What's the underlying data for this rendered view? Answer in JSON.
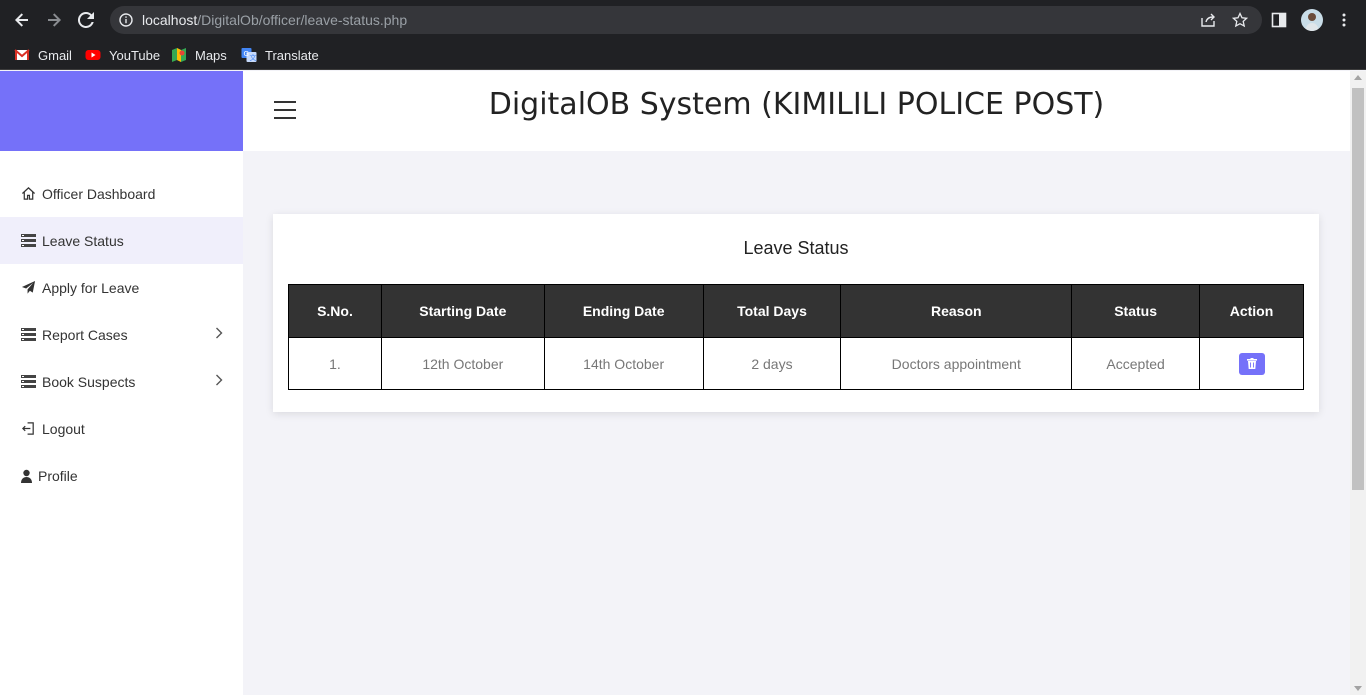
{
  "browser": {
    "url_host": "localhost",
    "url_path": "/DigitalOb/officer/leave-status.php",
    "bookmarks": [
      {
        "label": "Gmail",
        "icon": "gmail-icon"
      },
      {
        "label": "YouTube",
        "icon": "youtube-icon"
      },
      {
        "label": "Maps",
        "icon": "maps-icon"
      },
      {
        "label": "Translate",
        "icon": "translate-icon"
      }
    ]
  },
  "header": {
    "title": "DigitalOB System (KIMILILI POLICE POST)"
  },
  "sidebar": {
    "brand_color": "#7571f9",
    "items": [
      {
        "label": "Officer Dashboard",
        "icon": "home-icon",
        "active": false,
        "has_submenu": false
      },
      {
        "label": "Leave Status",
        "icon": "list-icon",
        "active": true,
        "has_submenu": false
      },
      {
        "label": "Apply for Leave",
        "icon": "paper-plane-icon",
        "active": false,
        "has_submenu": false
      },
      {
        "label": "Report Cases",
        "icon": "list-icon",
        "active": false,
        "has_submenu": true
      },
      {
        "label": "Book Suspects",
        "icon": "list-icon",
        "active": false,
        "has_submenu": true
      },
      {
        "label": "Logout",
        "icon": "logout-icon",
        "active": false,
        "has_submenu": false
      },
      {
        "label": "Profile",
        "icon": "user-icon",
        "active": false,
        "has_submenu": false
      }
    ]
  },
  "main": {
    "card_title": "Leave Status",
    "table": {
      "columns": [
        "S.No.",
        "Starting Date",
        "Ending Date",
        "Total Days",
        "Reason",
        "Status",
        "Action"
      ],
      "rows": [
        {
          "sno": "1.",
          "start": "12th October",
          "end": "14th October",
          "days": "2 days",
          "reason": "Doctors appointment",
          "status": "Accepted",
          "action_icon": "trash-icon"
        }
      ]
    }
  }
}
